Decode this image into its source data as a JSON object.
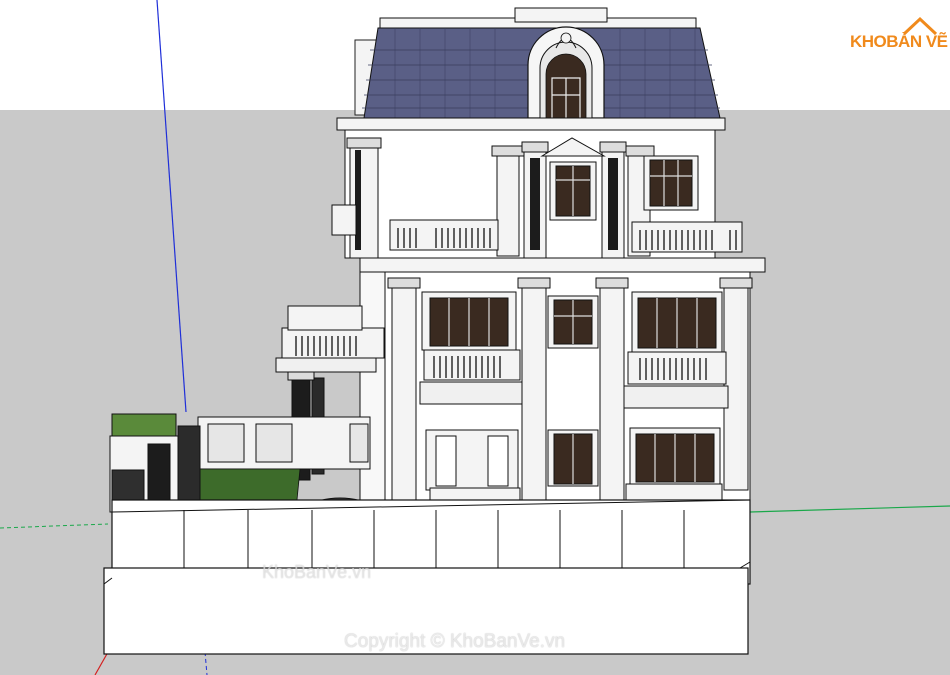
{
  "logo": {
    "prefix": "KHO",
    "suffix": "BẢN VẼ"
  },
  "watermarks": {
    "center": "KhoBanVe.vn",
    "copyright": "Copyright © KhoBanVe.vn"
  },
  "colors": {
    "ground": "#c9c9c9",
    "roof": "#5a5f86",
    "axis_blue": "#1f2fd8",
    "axis_green": "#1aa84a",
    "axis_red": "#d42020",
    "lawn": "#3d6b2a",
    "logo_orange": "#f08a1c"
  }
}
